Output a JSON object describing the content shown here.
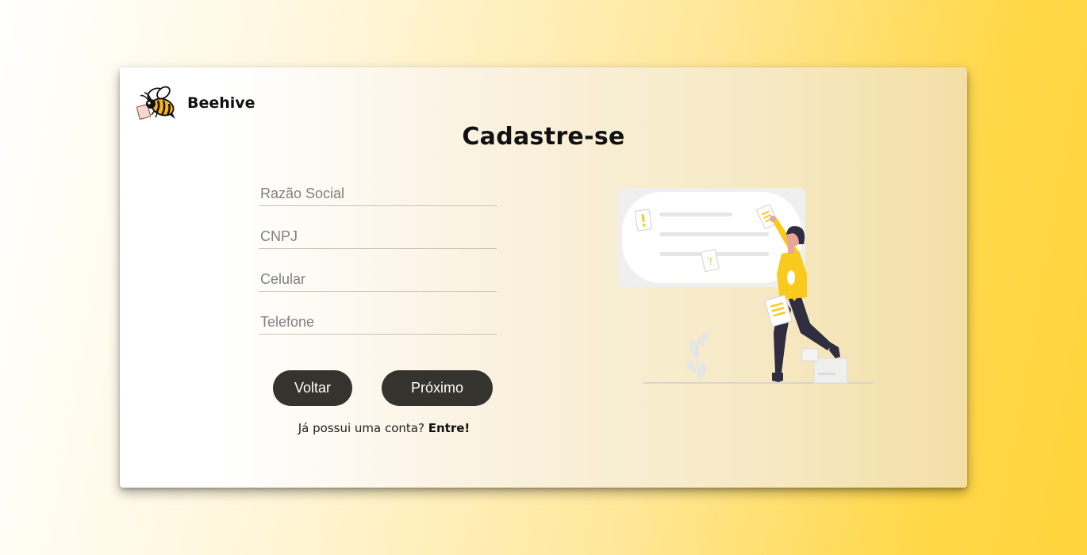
{
  "brand": {
    "name": "Beehive",
    "logo_icon": "bee-icon"
  },
  "page": {
    "title": "Cadastre-se"
  },
  "form": {
    "fields": [
      {
        "placeholder": "Razão Social",
        "value": ""
      },
      {
        "placeholder": "CNPJ",
        "value": ""
      },
      {
        "placeholder": "Celular",
        "value": ""
      },
      {
        "placeholder": "Telefone",
        "value": ""
      }
    ],
    "back_label": "Voltar",
    "next_label": "Próximo"
  },
  "login": {
    "prompt": "Já possui uma conta?",
    "link_label": "Entre!"
  },
  "colors": {
    "button_bg": "#35332e",
    "accent_yellow": "#f9c91c",
    "background_end": "#ffd43b"
  },
  "illustration": {
    "icon": "woman-with-notes-illustration"
  }
}
